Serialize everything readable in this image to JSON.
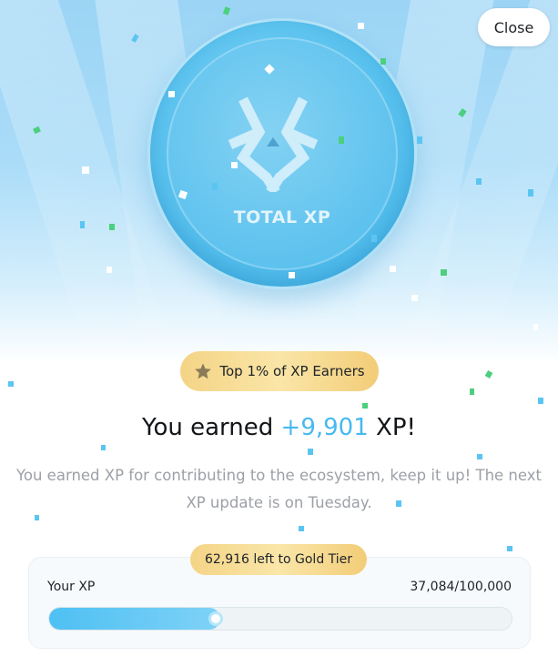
{
  "close_button": {
    "label": "Close"
  },
  "coin": {
    "label": "TOTAL XP",
    "logo_icon": "total-xp-logo-icon"
  },
  "rank_badge": {
    "icon": "star-icon",
    "label": "Top 1% of XP Earners"
  },
  "headline": {
    "prefix": "You earned ",
    "amount": "+9,901",
    "suffix": " XP!"
  },
  "subtext": "You earned XP for contributing to the ecosystem, keep it up! The next XP update is on Tuesday.",
  "progress": {
    "tier_label": "62,916 left to Gold Tier",
    "label": "Your XP",
    "count_text": "37,084/100,000",
    "current": 37084,
    "target": 100000
  },
  "colors": {
    "accent": "#47b9ef",
    "gold": "#f4d486",
    "confetti_green": "#4ccf7e",
    "confetti_blue": "#5bc5f2"
  }
}
